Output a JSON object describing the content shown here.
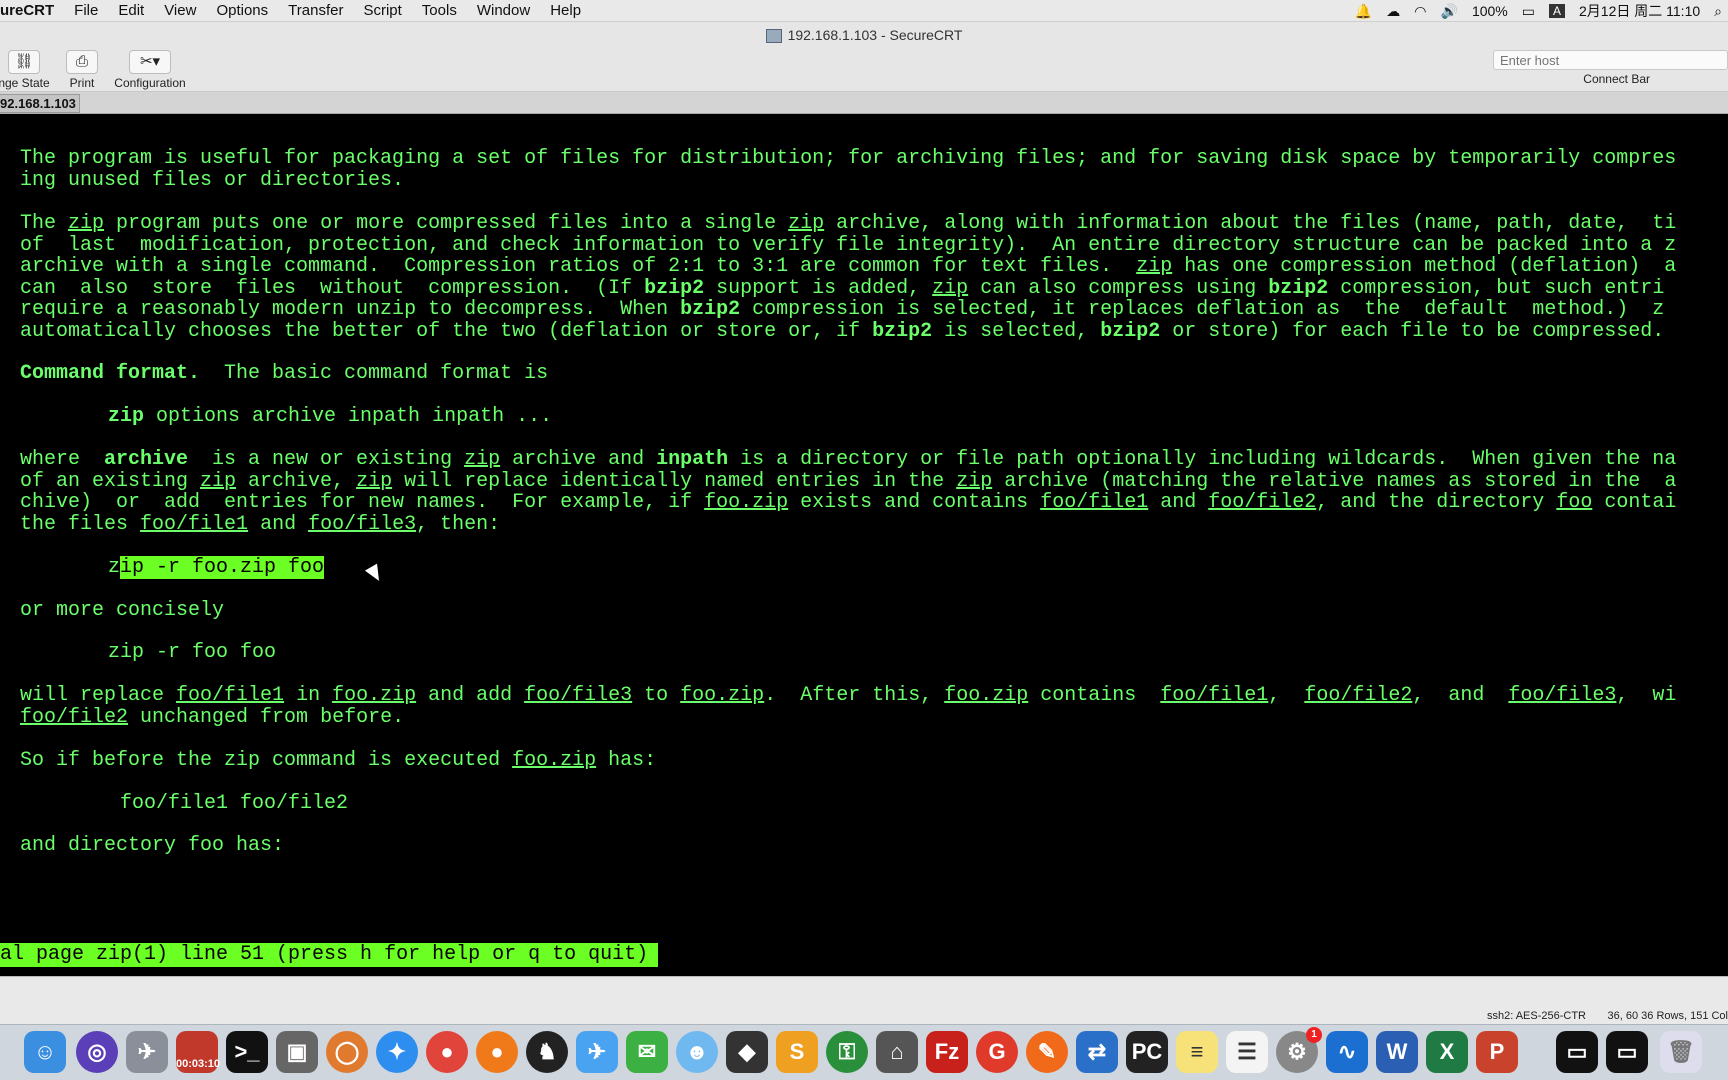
{
  "menubar": {
    "app": "ureCRT",
    "items": [
      "File",
      "Edit",
      "View",
      "Options",
      "Transfer",
      "Script",
      "Tools",
      "Window",
      "Help"
    ],
    "battery": "100%",
    "input_method": "A",
    "datetime": "2月12日 周二 11:10"
  },
  "window": {
    "title": "192.168.1.103 - SecureCRT"
  },
  "toolbar": {
    "change_state_label": "nge State",
    "print_label": "Print",
    "configuration_label": "Configuration",
    "host_placeholder": "Enter host",
    "connect_bar_label": "Connect Bar"
  },
  "tab": {
    "label": "92.168.1.103"
  },
  "terminal": {
    "colors": {
      "text": "#6bff6b",
      "background": "#000000",
      "highlight": "#6bff24"
    },
    "l1": "The program is useful for packaging a set of files for distribution; for archiving files; and for saving disk space by temporarily compres",
    "l2": "ing unused files or directories.",
    "l3_a": "The ",
    "l3_b": "zip",
    "l3_c": " program puts one or more compressed files into a single ",
    "l3_d": "zip",
    "l3_e": " archive, along with information about the files (name, path, date,  ti",
    "l4": "of  last  modification, protection, and check information to verify file integrity).  An entire directory structure can be packed into a z",
    "l5_a": "archive with a single command.  Compression ratios of 2:1 to 3:1 are common for text files.  ",
    "l5_b": "zip",
    "l5_c": " has one compression method (deflation)  a",
    "l6_a": "can  also  store  files  without  compression.  (If ",
    "l6_b": "bzip2",
    "l6_c": " support is added, ",
    "l6_d": "zip",
    "l6_e": " can also compress using ",
    "l6_f": "bzip2",
    "l6_g": " compression, but such entri",
    "l7_a": "require a reasonably modern unzip to decompress.  When ",
    "l7_b": "bzip2",
    "l7_c": " compression is selected, it replaces deflation as  the  default  method.)  z",
    "l8_a": "automatically chooses the better of the two (deflation or store or, if ",
    "l8_b": "bzip2",
    "l8_c": " is selected, ",
    "l8_d": "bzip2",
    "l8_e": " or store) for each file to be compressed.",
    "l9_a": "Command format.",
    "l9_b": "  The basic command format is",
    "l10_a": "zip",
    "l10_b": " options archive inpath inpath ...",
    "l11_a": "where  ",
    "l11_b": "archive",
    "l11_c": "  is a new or existing ",
    "l11_d": "zip",
    "l11_e": " archive and ",
    "l11_f": "inpath",
    "l11_g": " is a directory or file path optionally including wildcards.  When given the na",
    "l12_a": "of an existing ",
    "l12_b": "zip",
    "l12_c": " archive, ",
    "l12_d": "zip",
    "l12_e": " will replace identically named entries in the ",
    "l12_f": "zip",
    "l12_g": " archive (matching the relative names as stored in the  a",
    "l13_a": "chive)  or  add  entries for new names.  For example, if ",
    "l13_b": "foo.zip",
    "l13_c": " exists and contains ",
    "l13_d": "foo/file1",
    "l13_e": " and ",
    "l13_f": "foo/file2",
    "l13_g": ", and the directory ",
    "l13_h": "foo",
    "l13_i": " contai",
    "l14_a": "the files ",
    "l14_b": "foo/file1",
    "l14_c": " and ",
    "l14_d": "foo/file3",
    "l14_e": ", then:",
    "l15_a": "z",
    "l15_b": "ip -r foo.zip foo",
    "l16": "or more concisely",
    "l17": "zip -r foo foo",
    "l18_a": "will replace ",
    "l18_b": "foo/file1",
    "l18_c": " in ",
    "l18_d": "foo.zip",
    "l18_e": " and add ",
    "l18_f": "foo/file3",
    "l18_g": " to ",
    "l18_h": "foo.zip",
    "l18_i": ".  After this, ",
    "l18_j": "foo.zip",
    "l18_k": " contains  ",
    "l18_l": "foo/file1",
    "l18_m": ",  ",
    "l18_n": "foo/file2",
    "l18_o": ",  and  ",
    "l18_p": "foo/file3",
    "l18_q": ",  wi",
    "l19_a": "foo/file2",
    "l19_b": " unchanged from before.",
    "l20_a": "So if before the zip command is executed ",
    "l20_b": "foo.zip",
    "l20_c": " has:",
    "l21": "foo/file1 foo/file2",
    "l22": "and directory foo has:",
    "pager": "al page zip(1) line 51 (press h for help or q to quit)"
  },
  "statusbar": {
    "cipher": "ssh2: AES-256-CTR",
    "position": "36, 60  36 Rows, 151 Col"
  },
  "dock": {
    "recording_time": "00:03:10",
    "badge": "1"
  }
}
